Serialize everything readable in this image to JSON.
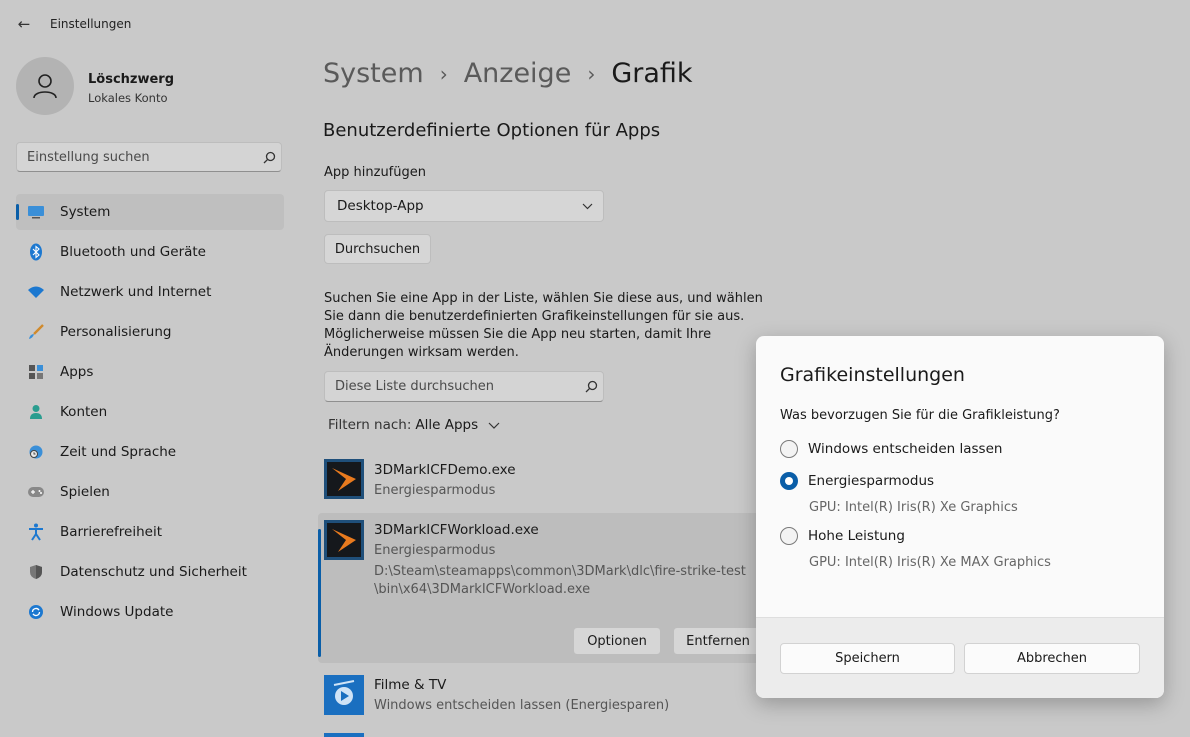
{
  "window": {
    "title": "Einstellungen"
  },
  "profile": {
    "name": "Löschzwerg",
    "account": "Lokales Konto"
  },
  "search": {
    "placeholder": "Einstellung suchen"
  },
  "sidebar": {
    "items": [
      {
        "label": "System",
        "icon": "monitor-icon"
      },
      {
        "label": "Bluetooth und Geräte",
        "icon": "bluetooth-icon"
      },
      {
        "label": "Netzwerk und Internet",
        "icon": "wifi-icon"
      },
      {
        "label": "Personalisierung",
        "icon": "brush-icon"
      },
      {
        "label": "Apps",
        "icon": "apps-icon"
      },
      {
        "label": "Konten",
        "icon": "person-icon"
      },
      {
        "label": "Zeit und Sprache",
        "icon": "globe-clock-icon"
      },
      {
        "label": "Spielen",
        "icon": "gamepad-icon"
      },
      {
        "label": "Barrierefreiheit",
        "icon": "accessibility-icon"
      },
      {
        "label": "Datenschutz und Sicherheit",
        "icon": "shield-icon"
      },
      {
        "label": "Windows Update",
        "icon": "update-icon"
      }
    ]
  },
  "breadcrumb": {
    "part1": "System",
    "part2": "Anzeige",
    "current": "Grafik"
  },
  "main": {
    "section_title": "Benutzerdefinierte Optionen für Apps",
    "add_label": "App hinzufügen",
    "dropdown_value": "Desktop-App",
    "browse_label": "Durchsuchen",
    "description": "Suchen Sie eine App in der Liste, wählen Sie diese aus, und wählen Sie dann die benutzerdefinierten Grafikeinstellungen für sie aus. Möglicherweise müssen Sie die App neu starten, damit Ihre Änderungen wirksam werden.",
    "list_search_placeholder": "Diese Liste durchsuchen",
    "filter_label": "Filtern nach:",
    "filter_value": "Alle Apps",
    "apps": [
      {
        "name": "3DMarkICFDemo.exe",
        "mode": "Energiesparmodus"
      },
      {
        "name": "3DMarkICFWorkload.exe",
        "mode": "Energiesparmodus",
        "path1": "D:\\Steam\\steamapps\\common\\3DMark\\dlc\\fire-strike-test",
        "path2": "\\bin\\x64\\3DMarkICFWorkload.exe"
      },
      {
        "name": "Filme & TV",
        "mode": "Windows entscheiden lassen (Energiesparen)"
      }
    ],
    "options_label": "Optionen",
    "remove_label": "Entfernen"
  },
  "dialog": {
    "title": "Grafikeinstellungen",
    "question": "Was bevorzugen Sie für die Grafikleistung?",
    "options": [
      {
        "label": "Windows entscheiden lassen",
        "gpu": ""
      },
      {
        "label": "Energiesparmodus",
        "gpu": "GPU: Intel(R) Iris(R) Xe Graphics"
      },
      {
        "label": "Hohe Leistung",
        "gpu": "GPU: Intel(R) Iris(R) Xe MAX Graphics"
      }
    ],
    "selected": "Energiesparmodus",
    "save_label": "Speichern",
    "cancel_label": "Abbrechen"
  },
  "colors": {
    "accent": "#0a5ea8",
    "background": "#c9c9c9",
    "dialog": "#fafafa"
  }
}
